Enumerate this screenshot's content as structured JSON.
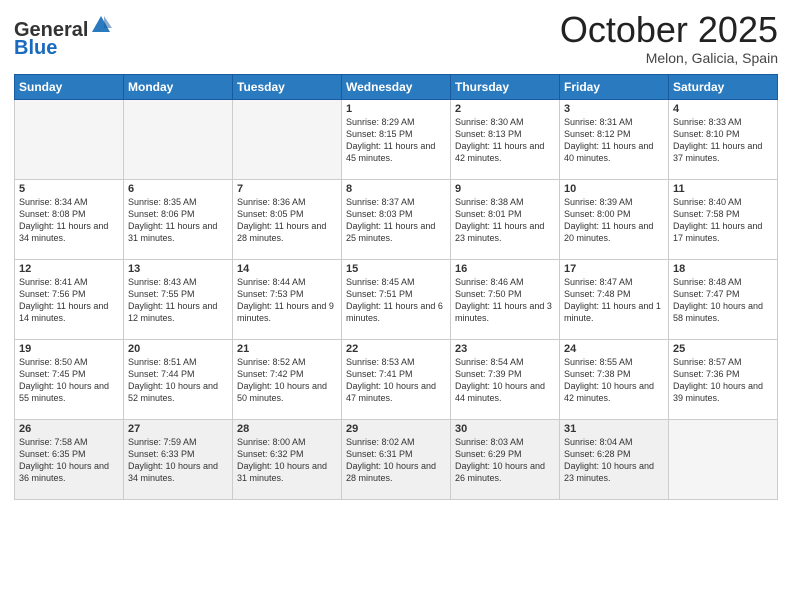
{
  "header": {
    "logo_general": "General",
    "logo_blue": "Blue",
    "title": "October 2025",
    "subtitle": "Melon, Galicia, Spain"
  },
  "days_of_week": [
    "Sunday",
    "Monday",
    "Tuesday",
    "Wednesday",
    "Thursday",
    "Friday",
    "Saturday"
  ],
  "weeks": [
    [
      {
        "day": "",
        "content": ""
      },
      {
        "day": "",
        "content": ""
      },
      {
        "day": "",
        "content": ""
      },
      {
        "day": "1",
        "content": "Sunrise: 8:29 AM\nSunset: 8:15 PM\nDaylight: 11 hours and 45 minutes."
      },
      {
        "day": "2",
        "content": "Sunrise: 8:30 AM\nSunset: 8:13 PM\nDaylight: 11 hours and 42 minutes."
      },
      {
        "day": "3",
        "content": "Sunrise: 8:31 AM\nSunset: 8:12 PM\nDaylight: 11 hours and 40 minutes."
      },
      {
        "day": "4",
        "content": "Sunrise: 8:33 AM\nSunset: 8:10 PM\nDaylight: 11 hours and 37 minutes."
      }
    ],
    [
      {
        "day": "5",
        "content": "Sunrise: 8:34 AM\nSunset: 8:08 PM\nDaylight: 11 hours and 34 minutes."
      },
      {
        "day": "6",
        "content": "Sunrise: 8:35 AM\nSunset: 8:06 PM\nDaylight: 11 hours and 31 minutes."
      },
      {
        "day": "7",
        "content": "Sunrise: 8:36 AM\nSunset: 8:05 PM\nDaylight: 11 hours and 28 minutes."
      },
      {
        "day": "8",
        "content": "Sunrise: 8:37 AM\nSunset: 8:03 PM\nDaylight: 11 hours and 25 minutes."
      },
      {
        "day": "9",
        "content": "Sunrise: 8:38 AM\nSunset: 8:01 PM\nDaylight: 11 hours and 23 minutes."
      },
      {
        "day": "10",
        "content": "Sunrise: 8:39 AM\nSunset: 8:00 PM\nDaylight: 11 hours and 20 minutes."
      },
      {
        "day": "11",
        "content": "Sunrise: 8:40 AM\nSunset: 7:58 PM\nDaylight: 11 hours and 17 minutes."
      }
    ],
    [
      {
        "day": "12",
        "content": "Sunrise: 8:41 AM\nSunset: 7:56 PM\nDaylight: 11 hours and 14 minutes."
      },
      {
        "day": "13",
        "content": "Sunrise: 8:43 AM\nSunset: 7:55 PM\nDaylight: 11 hours and 12 minutes."
      },
      {
        "day": "14",
        "content": "Sunrise: 8:44 AM\nSunset: 7:53 PM\nDaylight: 11 hours and 9 minutes."
      },
      {
        "day": "15",
        "content": "Sunrise: 8:45 AM\nSunset: 7:51 PM\nDaylight: 11 hours and 6 minutes."
      },
      {
        "day": "16",
        "content": "Sunrise: 8:46 AM\nSunset: 7:50 PM\nDaylight: 11 hours and 3 minutes."
      },
      {
        "day": "17",
        "content": "Sunrise: 8:47 AM\nSunset: 7:48 PM\nDaylight: 11 hours and 1 minute."
      },
      {
        "day": "18",
        "content": "Sunrise: 8:48 AM\nSunset: 7:47 PM\nDaylight: 10 hours and 58 minutes."
      }
    ],
    [
      {
        "day": "19",
        "content": "Sunrise: 8:50 AM\nSunset: 7:45 PM\nDaylight: 10 hours and 55 minutes."
      },
      {
        "day": "20",
        "content": "Sunrise: 8:51 AM\nSunset: 7:44 PM\nDaylight: 10 hours and 52 minutes."
      },
      {
        "day": "21",
        "content": "Sunrise: 8:52 AM\nSunset: 7:42 PM\nDaylight: 10 hours and 50 minutes."
      },
      {
        "day": "22",
        "content": "Sunrise: 8:53 AM\nSunset: 7:41 PM\nDaylight: 10 hours and 47 minutes."
      },
      {
        "day": "23",
        "content": "Sunrise: 8:54 AM\nSunset: 7:39 PM\nDaylight: 10 hours and 44 minutes."
      },
      {
        "day": "24",
        "content": "Sunrise: 8:55 AM\nSunset: 7:38 PM\nDaylight: 10 hours and 42 minutes."
      },
      {
        "day": "25",
        "content": "Sunrise: 8:57 AM\nSunset: 7:36 PM\nDaylight: 10 hours and 39 minutes."
      }
    ],
    [
      {
        "day": "26",
        "content": "Sunrise: 7:58 AM\nSunset: 6:35 PM\nDaylight: 10 hours and 36 minutes."
      },
      {
        "day": "27",
        "content": "Sunrise: 7:59 AM\nSunset: 6:33 PM\nDaylight: 10 hours and 34 minutes."
      },
      {
        "day": "28",
        "content": "Sunrise: 8:00 AM\nSunset: 6:32 PM\nDaylight: 10 hours and 31 minutes."
      },
      {
        "day": "29",
        "content": "Sunrise: 8:02 AM\nSunset: 6:31 PM\nDaylight: 10 hours and 28 minutes."
      },
      {
        "day": "30",
        "content": "Sunrise: 8:03 AM\nSunset: 6:29 PM\nDaylight: 10 hours and 26 minutes."
      },
      {
        "day": "31",
        "content": "Sunrise: 8:04 AM\nSunset: 6:28 PM\nDaylight: 10 hours and 23 minutes."
      },
      {
        "day": "",
        "content": ""
      }
    ]
  ]
}
